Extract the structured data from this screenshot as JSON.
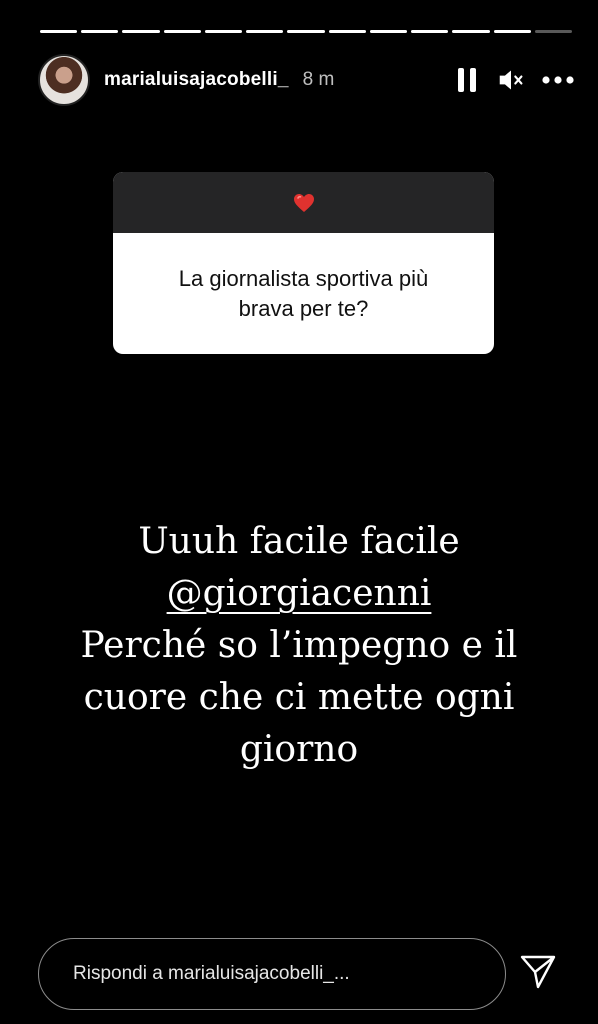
{
  "story": {
    "segments_total": 13,
    "segments_viewed": 12
  },
  "header": {
    "username": "marialuisajacobelli_",
    "time": "8 m"
  },
  "question_card": {
    "emoji": "❤️",
    "question": "La giornalista sportiva più brava per te?"
  },
  "story_text": {
    "line1": "Uuuh facile facile",
    "mention": "@giorgiacenni",
    "line3": "Perché so l’impegno e il",
    "line4": "cuore che ci mette ogni",
    "line5": "giorno"
  },
  "reply": {
    "placeholder": "Rispondi a marialuisajacobelli_..."
  },
  "icons": {
    "pause": "pause-icon",
    "mute": "speaker-muted-icon",
    "more": "more-horizontal-icon",
    "send": "send-icon"
  },
  "colors": {
    "background": "#000000",
    "card_header": "#252526",
    "card_body": "#ffffff"
  }
}
